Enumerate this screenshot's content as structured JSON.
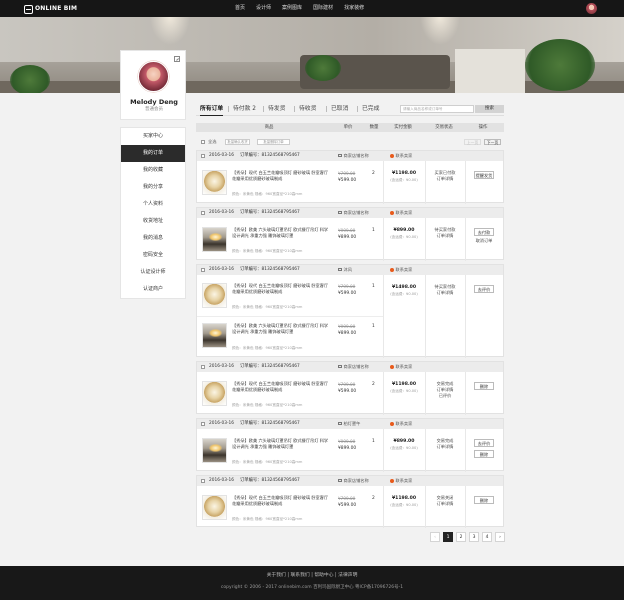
{
  "header": {
    "logo": "ONLINE BIM",
    "nav": [
      "首页",
      "设计师",
      "案例图库",
      "国际建材",
      "找家装修"
    ]
  },
  "profile": {
    "name": "Melody Deng",
    "role": "普通会员"
  },
  "sidebar": {
    "items": [
      "买家中心",
      "我的订单",
      "我的收藏",
      "我的分享",
      "个人资料",
      "收货地址",
      "我的消息",
      "密码安全",
      "认证设计师",
      "认证商户"
    ],
    "active_index": 1
  },
  "tabs": [
    {
      "label": "所有订单",
      "active": true
    },
    {
      "label": "待付款 2",
      "active": false
    },
    {
      "label": "待发货",
      "active": false
    },
    {
      "label": "待收货",
      "active": false
    },
    {
      "label": "已取消",
      "active": false
    },
    {
      "label": "已完成",
      "active": false
    }
  ],
  "search": {
    "placeholder": "请输入商品名称或订单号",
    "button": "搜索"
  },
  "table_headers": [
    "商品",
    "单价",
    "数量",
    "实付金额",
    "交易状态",
    "操作"
  ],
  "controls": {
    "select_all": "全选",
    "batch_confirm": "批量确认收货",
    "batch_delete": "批量删除订单",
    "prev": "上一页",
    "next": "下一页"
  },
  "orders": [
    {
      "date": "2016-03-16",
      "order_no": "订单编号：81324568795467",
      "shop": "商家店铺名称",
      "contact": "联系卖家",
      "items": [
        {
          "title": "【秀朵】现代 白玉兰花瓣吸顶灯 磨砂玻璃 卧室客厅 花瓣采用优质磨砂玻璃制成",
          "spec": "颜色：米黄色   规格：960宽直径*210高mm",
          "old_price": "¥799.00",
          "price": "¥599.00",
          "qty": "2"
        }
      ],
      "total": "¥1198.00",
      "shipping": "(含运费：¥0.00)",
      "status": [
        "买家已付款",
        "订单详情"
      ],
      "buttons": [
        "提醒发货"
      ],
      "links": []
    },
    {
      "date": "2016-03-16",
      "order_no": "订单编号：81324568795467",
      "shop": "商家店铺名称",
      "contact": "联系卖家",
      "items": [
        {
          "title": "【秀朵】欧美 六头玻璃灯罩吊灯 欧式餐厅吊灯 科学设计调光 承重力强 雕饰玻璃灯罩",
          "spec": "颜色：米黄色   规格：960宽直径*210高mm",
          "old_price": "¥999.00",
          "price": "¥899.00",
          "qty": "1"
        }
      ],
      "total": "¥899.00",
      "shipping": "(含运费：¥0.00)",
      "status": [
        "待买家付款",
        "订单详情"
      ],
      "buttons": [
        "去付款"
      ],
      "links": [
        "取消订单"
      ]
    },
    {
      "date": "2016-03-16",
      "order_no": "订单编号：81324568795467",
      "shop": "沐风",
      "contact": "联系卖家",
      "items": [
        {
          "title": "【秀朵】现代 白玉兰花瓣吸顶灯 磨砂玻璃 卧室客厅 花瓣采用优质磨砂玻璃制成",
          "spec": "颜色：米黄色   规格：960宽直径*210高mm",
          "old_price": "¥799.00",
          "price": "¥599.00",
          "qty": "1"
        },
        {
          "title": "【秀朵】欧美 六头玻璃灯罩吊灯 欧式餐厅吊灯 科学设计调光 承重力强 雕饰玻璃灯罩",
          "spec": "颜色：米黄色   规格：960宽直径*210高mm",
          "old_price": "¥999.00",
          "price": "¥899.00",
          "qty": "1"
        }
      ],
      "total": "¥1498.00",
      "shipping": "(含运费：¥0.00)",
      "status": [
        "待买家付款",
        "订单详情"
      ],
      "buttons": [
        "去评价"
      ],
      "links": []
    },
    {
      "date": "2016-03-16",
      "order_no": "订单编号：81324568795467",
      "shop": "商家店铺名称",
      "contact": "联系卖家",
      "items": [
        {
          "title": "【秀朵】现代 白玉兰花瓣吸顶灯 磨砂玻璃 卧室客厅 花瓣采用优质磨砂玻璃制成",
          "spec": "颜色：米黄色   规格：960宽直径*210高mm",
          "old_price": "¥799.00",
          "price": "¥599.00",
          "qty": "2"
        }
      ],
      "total": "¥1198.00",
      "shipping": "(含运费：¥0.00)",
      "status": [
        "交易完成",
        "订单详情",
        "已评价"
      ],
      "buttons": [
        "删除"
      ],
      "links": []
    },
    {
      "date": "2016-03-16",
      "order_no": "订单编号：81324568795467",
      "shop": "柏灯罩午",
      "contact": "联系卖家",
      "items": [
        {
          "title": "【秀朵】欧美 六头玻璃灯罩吊灯 欧式餐厅吊灯 科学设计调光 承重力强 雕饰玻璃灯罩",
          "spec": "颜色：米黄色   规格：960宽直径*210高mm",
          "old_price": "¥999.00",
          "price": "¥899.00",
          "qty": "1"
        }
      ],
      "total": "¥899.00",
      "shipping": "(含运费：¥0.00)",
      "status": [
        "交易完成",
        "订单详情"
      ],
      "buttons": [
        "去评价",
        "删除"
      ],
      "links": []
    },
    {
      "date": "2016-03-16",
      "order_no": "订单编号：81324568795467",
      "shop": "商家店铺名称",
      "contact": "联系卖家",
      "items": [
        {
          "title": "【秀朵】现代 白玉兰花瓣吸顶灯 磨砂玻璃 卧室客厅 花瓣采用优质磨砂玻璃制成",
          "spec": "颜色：米黄色   规格：960宽直径*210高mm",
          "old_price": "¥799.00",
          "price": "¥599.00",
          "qty": "2"
        }
      ],
      "total": "¥1198.00",
      "shipping": "(含运费：¥0.00)",
      "status": [
        "交易关闭",
        "订单详情"
      ],
      "buttons": [
        "删除"
      ],
      "links": []
    }
  ],
  "pagination": {
    "prev": "‹",
    "pages": [
      "1",
      "2",
      "3",
      "4"
    ],
    "next": "›",
    "active": "1"
  },
  "footer": {
    "links": "关于我们  |  联系我们  |  帮助中心  |  法律声明",
    "copyright": "copyright © 2006 - 2017 onlinebim.com   百利玛国际厨卫中心   粤ICP备17096726号-1"
  },
  "colors": {
    "accent": "#222222",
    "contact_icon": "#e85a1b"
  }
}
